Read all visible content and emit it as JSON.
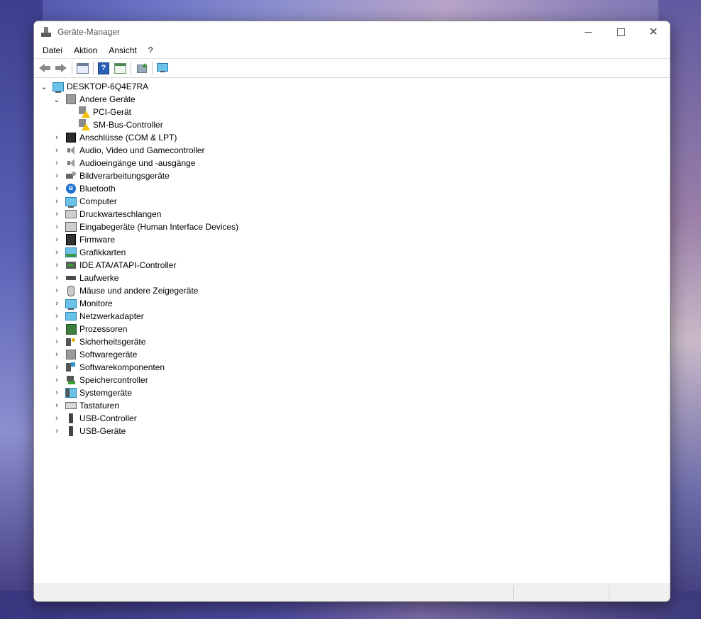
{
  "window": {
    "title": "Geräte-Manager"
  },
  "menu": [
    "Datei",
    "Aktion",
    "Ansicht",
    "?"
  ],
  "tree": {
    "root": {
      "label": "DESKTOP-6Q4E7RA",
      "expanded": true
    },
    "categories": [
      {
        "label": "Andere Geräte",
        "icon": "unknown-device-icon",
        "expanded": true,
        "children": [
          {
            "label": "PCI-Gerät",
            "icon": "warning-device-icon"
          },
          {
            "label": "SM-Bus-Controller",
            "icon": "warning-device-icon"
          }
        ]
      },
      {
        "label": "Anschlüsse (COM & LPT)",
        "icon": "port-icon"
      },
      {
        "label": "Audio, Video und Gamecontroller",
        "icon": "speaker-icon"
      },
      {
        "label": "Audioeingänge und -ausgänge",
        "icon": "speaker-icon"
      },
      {
        "label": "Bildverarbeitungsgeräte",
        "icon": "camera-icon"
      },
      {
        "label": "Bluetooth",
        "icon": "bluetooth-icon"
      },
      {
        "label": "Computer",
        "icon": "computer-icon"
      },
      {
        "label": "Druckwarteschlangen",
        "icon": "printer-icon"
      },
      {
        "label": "Eingabegeräte (Human Interface Devices)",
        "icon": "hid-icon"
      },
      {
        "label": "Firmware",
        "icon": "firmware-icon"
      },
      {
        "label": "Grafikkarten",
        "icon": "display-adapter-icon"
      },
      {
        "label": "IDE ATA/ATAPI-Controller",
        "icon": "ide-controller-icon"
      },
      {
        "label": "Laufwerke",
        "icon": "disk-drive-icon"
      },
      {
        "label": "Mäuse und andere Zeigegeräte",
        "icon": "mouse-icon"
      },
      {
        "label": "Monitore",
        "icon": "monitor-icon"
      },
      {
        "label": "Netzwerkadapter",
        "icon": "network-adapter-icon"
      },
      {
        "label": "Prozessoren",
        "icon": "processor-icon"
      },
      {
        "label": "Sicherheitsgeräte",
        "icon": "security-device-icon"
      },
      {
        "label": "Softwaregeräte",
        "icon": "software-device-icon"
      },
      {
        "label": "Softwarekomponenten",
        "icon": "software-component-icon"
      },
      {
        "label": "Speichercontroller",
        "icon": "storage-controller-icon"
      },
      {
        "label": "Systemgeräte",
        "icon": "system-device-icon"
      },
      {
        "label": "Tastaturen",
        "icon": "keyboard-icon"
      },
      {
        "label": "USB-Controller",
        "icon": "usb-icon"
      },
      {
        "label": "USB-Geräte",
        "icon": "usb-icon"
      }
    ]
  },
  "colors": {
    "accent": "#2b7fb0",
    "warning": "#f2c100",
    "window_bg": "#ffffff"
  }
}
